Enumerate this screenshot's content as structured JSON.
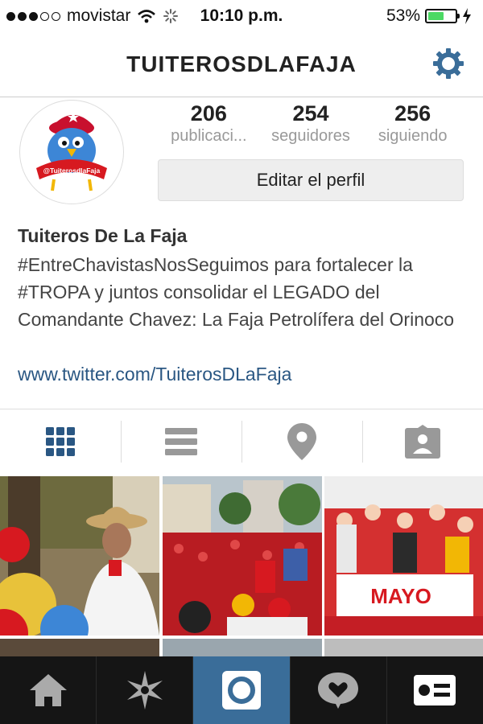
{
  "status_bar": {
    "carrier": "movistar",
    "time": "10:10 p.m.",
    "battery": "53%",
    "battery_level": 0.53,
    "signal_bars_filled": 3,
    "signal_bars_total": 5
  },
  "header": {
    "title": "TUITEROSDLAFAJA",
    "settings_icon": "gear-icon"
  },
  "profile": {
    "avatar_text": "@TuiterosdlaFaja",
    "stats": [
      {
        "value": "206",
        "label": "publicaci..."
      },
      {
        "value": "254",
        "label": "seguidores"
      },
      {
        "value": "256",
        "label": "siguiendo"
      }
    ],
    "edit_button": "Editar el perfil",
    "name": "Tuiteros De La Faja",
    "bio": "#EntreChavistasNosSeguimos para fortalecer la #TROPA y juntos consolidar el LEGADO del Comandante Chavez: La Faja Petrolífera del Orinoco",
    "website": "www.twitter.com/TuiterosDLaFaja"
  },
  "view_tabs": [
    "grid-view-icon",
    "list-view-icon",
    "map-pin-icon",
    "tagged-photos-icon"
  ],
  "grid_banner_text": "MAYO",
  "bottom_nav": [
    "home-icon",
    "explore-icon",
    "camera-icon",
    "activity-icon",
    "profile-icon"
  ],
  "colors": {
    "accent": "#2a5783",
    "active_nav": "#3a6d99",
    "battery_green": "#4cd964"
  }
}
